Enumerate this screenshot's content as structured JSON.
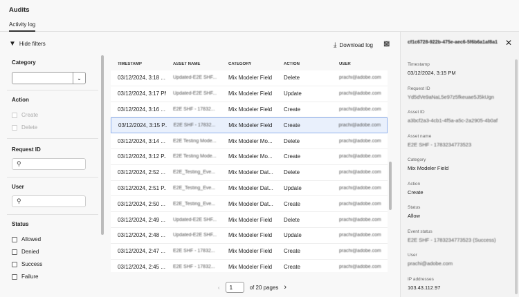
{
  "header": {
    "title": "Audits",
    "tab": "Activity log"
  },
  "filters": {
    "hide_label": "Hide filters",
    "category_label": "Category",
    "action_label": "Action",
    "actions": [
      "Create",
      "Delete"
    ],
    "request_id_label": "Request ID",
    "user_label": "User",
    "status_label": "Status",
    "statuses": [
      "Allowed",
      "Denied",
      "Success",
      "Failure"
    ]
  },
  "toolbar": {
    "download": "Download log"
  },
  "table": {
    "columns": [
      "TIMESTAMP",
      "ASSET NAME",
      "CATEGORY",
      "ACTION",
      "USER"
    ],
    "rows": [
      [
        "03/12/2024, 3:18 ...",
        "Updated-E2E SHF...",
        "Mix Modeler Field",
        "Delete",
        "prachi@adobe.com"
      ],
      [
        "03/12/2024, 3:17 PM",
        "Updated-E2E SHF...",
        "Mix Modeler Field",
        "Update",
        "prachi@adobe.com"
      ],
      [
        "03/12/2024, 3:16 ...",
        "E2E SHF - 17832...",
        "Mix Modeler Field",
        "Create",
        "prachi@adobe.com"
      ],
      [
        "03/12/2024, 3:15 P...",
        "E2E SHF - 17832...",
        "Mix Modeler Field",
        "Create",
        "prachi@adobe.com"
      ],
      [
        "03/12/2024, 3:14 ...",
        "E2E Testing Mode...",
        "Mix Modeler Mo...",
        "Delete",
        "prachi@adobe.com"
      ],
      [
        "03/12/2024, 3:12 P...",
        "E2E Testing Mode...",
        "Mix Modeler Mo...",
        "Create",
        "prachi@adobe.com"
      ],
      [
        "03/12/2024, 2:52 ...",
        "E2E_Testing_Eve...",
        "Mix Modeler Dat...",
        "Delete",
        "prachi@adobe.com"
      ],
      [
        "03/12/2024, 2:51 P...",
        "E2E_Testing_Eve...",
        "Mix Modeler Dat...",
        "Update",
        "prachi@adobe.com"
      ],
      [
        "03/12/2024, 2:50 ...",
        "E2E_Testing_Eve...",
        "Mix Modeler Dat...",
        "Create",
        "prachi@adobe.com"
      ],
      [
        "03/12/2024, 2:49 ...",
        "Updated-E2E SHF...",
        "Mix Modeler Field",
        "Delete",
        "prachi@adobe.com"
      ],
      [
        "03/12/2024, 2:48 ...",
        "Updated-E2E SHF...",
        "Mix Modeler Field",
        "Update",
        "prachi@adobe.com"
      ],
      [
        "03/12/2024, 2:47 ...",
        "E2E SHF - 17832...",
        "Mix Modeler Field",
        "Create",
        "prachi@adobe.com"
      ],
      [
        "03/12/2024, 2:45 ...",
        "E2E SHF - 17832...",
        "Mix Modeler Field",
        "Create",
        "prachi@adobe.com"
      ]
    ],
    "selected_index": 3
  },
  "pager": {
    "page": "1",
    "of": "of 20 pages"
  },
  "detail": {
    "title": "cf1c6728-922b-475e-aec6-5f6b6a1af8a1",
    "fields": [
      {
        "label": "Timestamp",
        "value": "03/12/2024, 3:15 PM",
        "blur": false
      },
      {
        "label": "Request ID",
        "value": "Yd5dVe9aNaL5e97z5fkeuae5J5kUgn",
        "blur": true
      },
      {
        "label": "Asset ID",
        "value": "a3bcf2a3-4cb1-4f5a-a5c-2a2905-4b0af",
        "blur": true
      },
      {
        "label": "Asset name",
        "value": "E2E SHF - 1783234773523",
        "blur": true
      },
      {
        "label": "Category",
        "value": "Mix Modeler Field",
        "blur": false
      },
      {
        "label": "Action",
        "value": "Create",
        "blur": false
      },
      {
        "label": "Status",
        "value": "Allow",
        "blur": false
      },
      {
        "label": "Event status",
        "value": "E2E SHF - 1783234773523 (Success)",
        "blur": true
      },
      {
        "label": "User",
        "value": "prachi@adobe.com",
        "blur": true
      },
      {
        "label": "IP addresses",
        "value": "103.43.112.97",
        "blur": false
      }
    ]
  }
}
